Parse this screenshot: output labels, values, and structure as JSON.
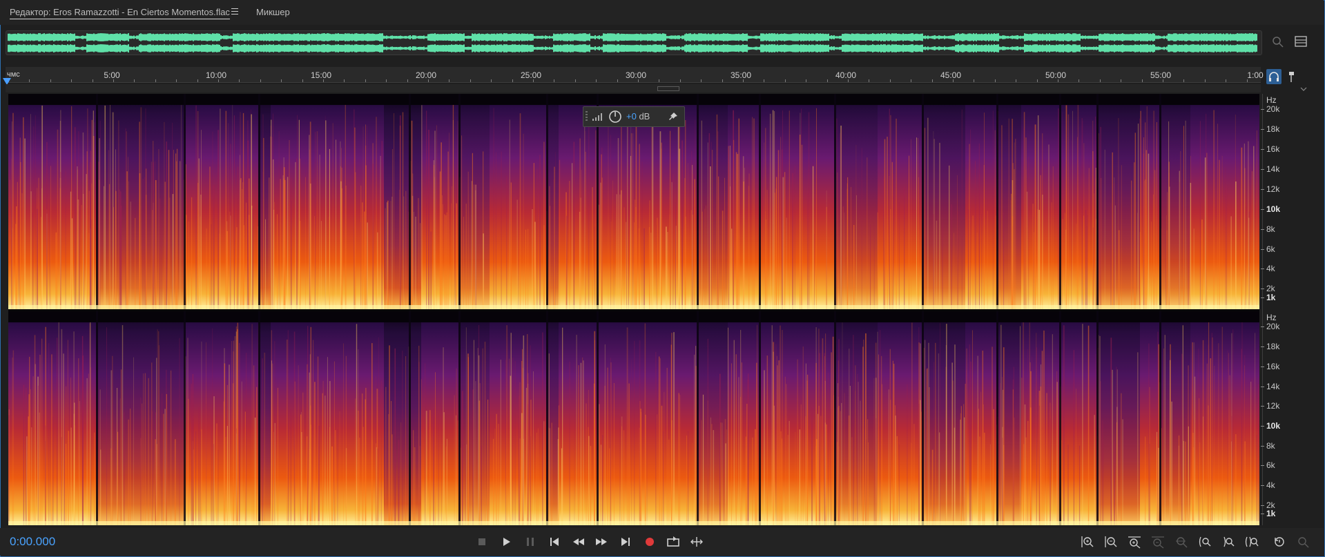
{
  "tabs": [
    {
      "label": "Редактор: Eros Ramazzotti - En Ciertos Momentos.flac",
      "active": true
    },
    {
      "label": "Микшер",
      "active": false
    }
  ],
  "ruler": {
    "unit": "чмс",
    "labels": [
      "5:00",
      "10:00",
      "15:00",
      "20:00",
      "25:00",
      "30:00",
      "35:00",
      "40:00",
      "45:00",
      "50:00",
      "55:00",
      "1:00"
    ]
  },
  "hud": {
    "gain": "+0",
    "unit": "dB"
  },
  "spectral_axis": {
    "unit": "Hz",
    "labels": [
      "20k",
      "18k",
      "16k",
      "14k",
      "12k",
      "10k",
      "8k",
      "6k",
      "4k",
      "2k",
      "1k"
    ]
  },
  "transport": {
    "current_time": "0:00.000"
  },
  "colors": {
    "accent": "#4aa3ff",
    "overview_wave": "#5fe0a8",
    "record": "#e03a3a"
  }
}
